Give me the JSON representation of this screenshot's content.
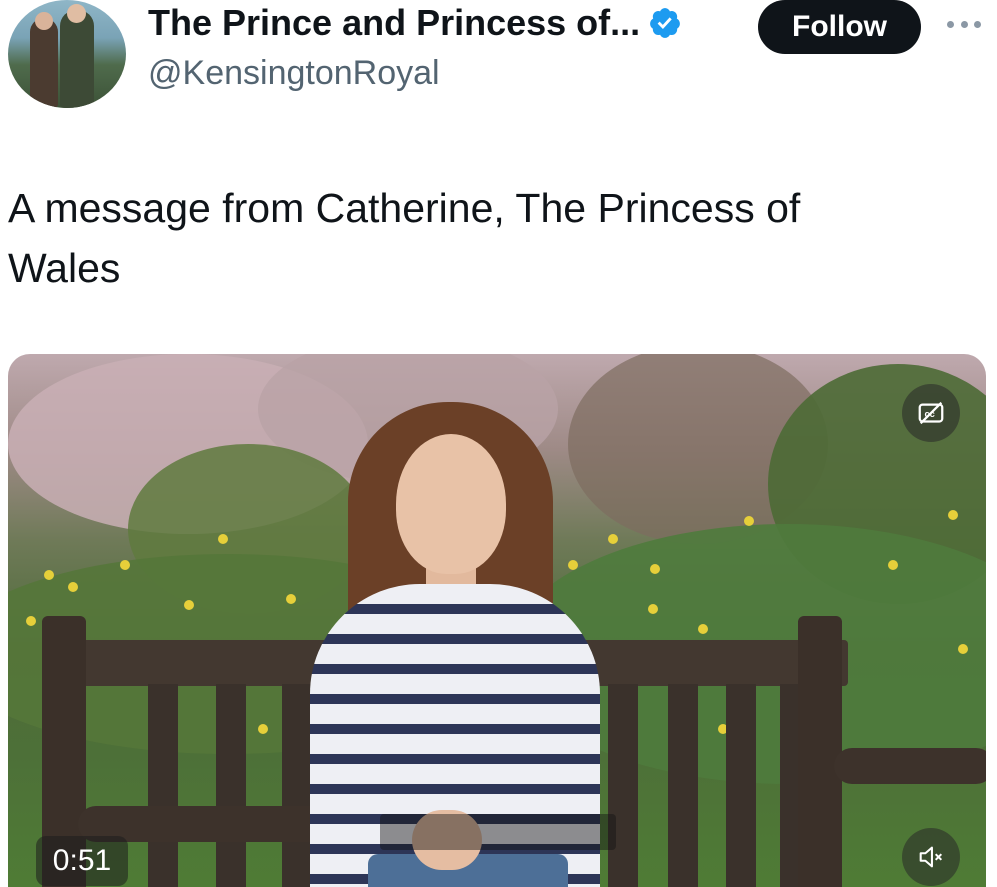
{
  "account": {
    "name": "The Prince and Princess of...",
    "handle": "@KensingtonRoyal",
    "verified": true,
    "verified_color": "#1d9bf0"
  },
  "actions": {
    "follow_label": "Follow"
  },
  "icons": {
    "more": "more-horizontal-icon",
    "captions": "captions-off-icon",
    "mute": "speaker-muted-icon"
  },
  "tweet": {
    "text": "A message from Catherine, The Princess of Wales"
  },
  "video": {
    "duration_label": "0:51",
    "muted": true
  }
}
